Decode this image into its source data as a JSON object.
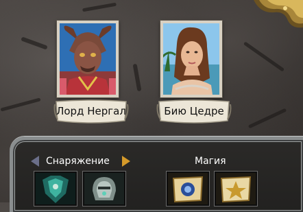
{
  "heroes": [
    {
      "name": "Лорд Нергал",
      "portrait_icon": "demon-lord-portrait-icon"
    },
    {
      "name": "Бию Цедре",
      "portrait_icon": "woman-hero-portrait-icon"
    }
  ],
  "equipment": {
    "label": "Снаряжение",
    "slots": [
      {
        "icon": "green-armor-item-icon"
      },
      {
        "icon": "silver-helmet-item-icon"
      }
    ]
  },
  "magic": {
    "label": "Магия",
    "slots": [
      {
        "icon": "blue-spell-scroll-icon"
      },
      {
        "icon": "gold-spell-scroll-icon"
      }
    ]
  },
  "colors": {
    "nav_arrow_left": "#6b6f8a",
    "nav_arrow_right": "#d59a2a",
    "panel_border": "#8a8e8f",
    "label_text": "#ffffff"
  }
}
